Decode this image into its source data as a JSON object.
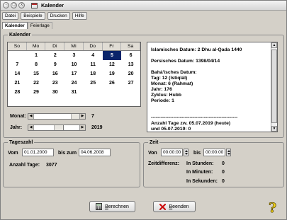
{
  "window": {
    "title": "Kalender"
  },
  "titlebar_buttons": [
    "-",
    "□",
    "x"
  ],
  "menu": [
    "Datei",
    "Beispiele",
    "Drucken",
    "Hilfe"
  ],
  "tabs": [
    {
      "label": "Kalender",
      "active": true
    },
    {
      "label": "Feierlage",
      "active": false
    }
  ],
  "calendar_group": {
    "label": "Kalender"
  },
  "calendar": {
    "weekdays": [
      "So",
      "Mo",
      "Di",
      "Mi",
      "Do",
      "Fr",
      "Sa"
    ],
    "weeks": [
      [
        "",
        "1",
        "2",
        "3",
        "4",
        "5",
        "6"
      ],
      [
        "7",
        "8",
        "9",
        "10",
        "11",
        "12",
        "13"
      ],
      [
        "14",
        "15",
        "16",
        "17",
        "18",
        "19",
        "20"
      ],
      [
        "21",
        "22",
        "23",
        "24",
        "25",
        "26",
        "27"
      ],
      [
        "28",
        "29",
        "30",
        "31",
        "",
        "",
        ""
      ]
    ],
    "selected_day": "5",
    "selected_color": "#0a246a"
  },
  "sliders": {
    "monat": {
      "label": "Monat:",
      "value": "7"
    },
    "jahr": {
      "label": "Jahr:",
      "value": "2019"
    }
  },
  "info": {
    "lines": [
      "Islamisches Datum: 2 Dhu al-Qada 1440",
      "",
      "Persisches Datum: 1398/04/14",
      "",
      "Bahá'ísches Datum:",
      "Tag: 12 (Istiqlál)",
      "Monat: 6 (Rahmat)",
      "Jahr: 176",
      "Zyklus: Hubb",
      "Periode: 1",
      "",
      "",
      "------------------------------------------------------",
      "Anzahl Tage zw. 05.07.2019 (heute)",
      "und 05.07.2019: 0"
    ]
  },
  "tageszahl": {
    "label": "Tageszahl",
    "vom_label": "Vom",
    "vom_value": "01.01.2000",
    "bis_label": "bis zum",
    "bis_value": "04.06.2008",
    "anzahl_label": "Anzahl Tage:",
    "anzahl_value": "3077"
  },
  "zeit": {
    "label": "Zeit",
    "von_label": "Von",
    "von_value": "00:00:00",
    "bis_label": "bis",
    "bis_value": "00:00:00",
    "diff_label": "Zeitdifferenz:",
    "stunden_label": "In Stunden:",
    "stunden_value": "0",
    "minuten_label": "In Minuten:",
    "minuten_value": "0",
    "sekunden_label": "In Sekunden:",
    "sekunden_value": "0"
  },
  "buttons": {
    "berechnen": "Berechnen",
    "beenden": "Beenden"
  },
  "icons": {
    "calc": "calculator-icon",
    "close": "close-x-icon",
    "help": "help-question-icon"
  },
  "colors": {
    "beenden_x": "#cc1111",
    "help_yellow": "#f2d21a"
  }
}
